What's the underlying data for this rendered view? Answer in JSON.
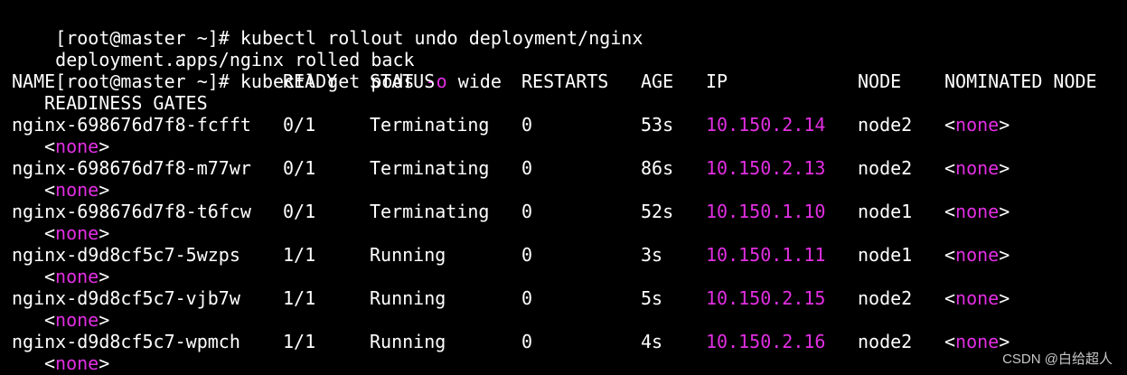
{
  "colors": {
    "background": "#000000",
    "foreground": "#ffffff",
    "highlight": "#e22ee2"
  },
  "commands": [
    {
      "prompt": "[root@master ~]# ",
      "cmd": "kubectl rollout undo deployment/nginx"
    },
    {
      "output": "deployment.apps/nginx rolled back"
    },
    {
      "prompt": "[root@master ~]# ",
      "cmd_pre": "kubectl get pods ",
      "flag": "-o",
      "cmd_post": " wide"
    }
  ],
  "table": {
    "headers": {
      "name": "NAME",
      "ready": "READY",
      "status": "STATUS",
      "restarts": "RESTARTS",
      "age": "AGE",
      "ip": "IP",
      "node": "NODE",
      "nominated": "NOMINATED NODE",
      "readiness": "READINESS GATES"
    },
    "rows": [
      {
        "name": "nginx-698676d7f8-fcfft",
        "ready": "0/1",
        "status": "Terminating",
        "restarts": "0",
        "age": "53s",
        "ip": "10.150.2.14",
        "node": "node2",
        "nominated": "none",
        "readiness": "none"
      },
      {
        "name": "nginx-698676d7f8-m77wr",
        "ready": "0/1",
        "status": "Terminating",
        "restarts": "0",
        "age": "86s",
        "ip": "10.150.2.13",
        "node": "node2",
        "nominated": "none",
        "readiness": "none"
      },
      {
        "name": "nginx-698676d7f8-t6fcw",
        "ready": "0/1",
        "status": "Terminating",
        "restarts": "0",
        "age": "52s",
        "ip": "10.150.1.10",
        "node": "node1",
        "nominated": "none",
        "readiness": "none"
      },
      {
        "name": "nginx-d9d8cf5c7-5wzps",
        "ready": "1/1",
        "status": "Running",
        "restarts": "0",
        "age": "3s",
        "ip": "10.150.1.11",
        "node": "node1",
        "nominated": "none",
        "readiness": "none"
      },
      {
        "name": "nginx-d9d8cf5c7-vjb7w",
        "ready": "1/1",
        "status": "Running",
        "restarts": "0",
        "age": "5s",
        "ip": "10.150.2.15",
        "node": "node2",
        "nominated": "none",
        "readiness": "none"
      },
      {
        "name": "nginx-d9d8cf5c7-wpmch",
        "ready": "1/1",
        "status": "Running",
        "restarts": "0",
        "age": "4s",
        "ip": "10.150.2.16",
        "node": "node2",
        "nominated": "none",
        "readiness": "none"
      }
    ]
  },
  "watermark": "CSDN @白给超人"
}
